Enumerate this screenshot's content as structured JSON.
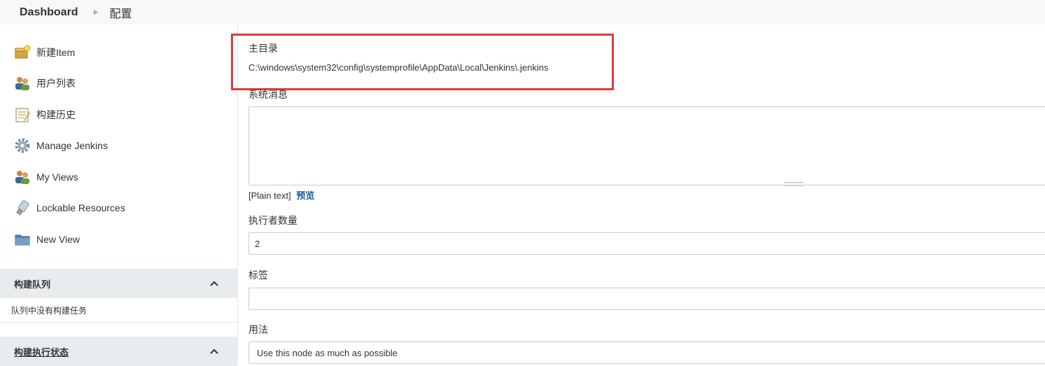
{
  "breadcrumb": {
    "home": "Dashboard",
    "separator_icon": "caret-right-icon",
    "current": "配置"
  },
  "sidebar": {
    "items": [
      {
        "label": "新建Item",
        "icon": "new-item-icon"
      },
      {
        "label": "用户列表",
        "icon": "users-icon"
      },
      {
        "label": "构建历史",
        "icon": "notepad-icon"
      },
      {
        "label": "Manage Jenkins",
        "icon": "gear-icon"
      },
      {
        "label": "My Views",
        "icon": "users-icon"
      },
      {
        "label": "Lockable Resources",
        "icon": "usb-drive-icon"
      },
      {
        "label": "New View",
        "icon": "folder-icon"
      }
    ],
    "queue": {
      "title": "构建队列",
      "empty_text": "队列中没有构建任务"
    },
    "executors": {
      "title": "构建执行状态"
    }
  },
  "main": {
    "home_dir": {
      "label": "主目录",
      "value": "C:\\windows\\system32\\config\\systemprofile\\AppData\\Local\\Jenkins\\.jenkins"
    },
    "system_message": {
      "label": "系统消息",
      "value": ""
    },
    "markup": {
      "format": "[Plain text]",
      "preview": "预览"
    },
    "executors": {
      "label": "执行者数量",
      "value": "2"
    },
    "labels": {
      "label": "标签",
      "value": ""
    },
    "usage": {
      "label": "用法",
      "value": "Use this node as much as possible"
    }
  },
  "colors": {
    "highlight": "#e53935",
    "link": "#1a5c9a",
    "pane_header": "#e9ecef"
  }
}
